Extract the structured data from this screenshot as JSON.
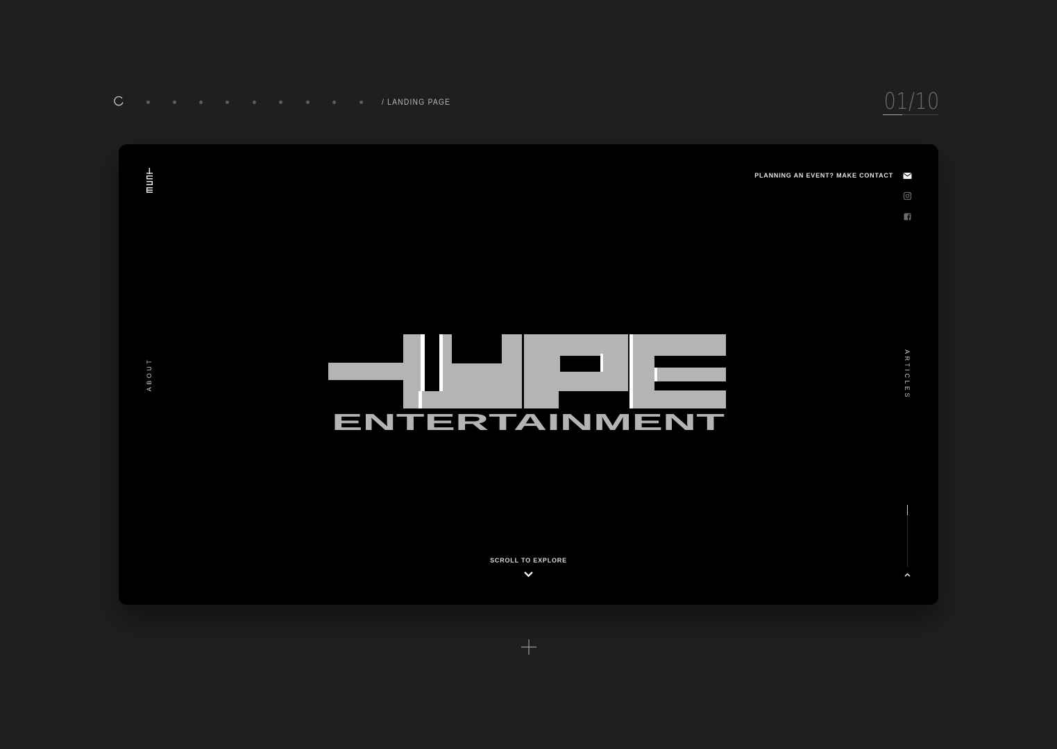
{
  "breadcrumb": "/ LANDING PAGE",
  "pagination": {
    "current": "01",
    "total": "10",
    "progress": 0.35,
    "dots": [
      "1",
      "2",
      "3",
      "4",
      "5",
      "6",
      "7",
      "8",
      "9"
    ]
  },
  "hero": {
    "logo_word": "HYPE",
    "logo_subtitle": "ENTERTAINMENT",
    "logo_fill": "#b4b4b4",
    "logo_highlight": "#ffffff"
  },
  "nav": {
    "about": "ABOUT",
    "articles": "ARTICLES",
    "contact": "PLANNING AN EVENT? MAKE CONTACT"
  },
  "social": {
    "icons": [
      "envelope-icon",
      "instagram-icon",
      "facebook-icon"
    ]
  },
  "scroll": {
    "label": "SCROLL TO EXPLORE",
    "progress": 0.17
  },
  "colors": {
    "background": "#1f1f1f",
    "card": "#000000"
  }
}
